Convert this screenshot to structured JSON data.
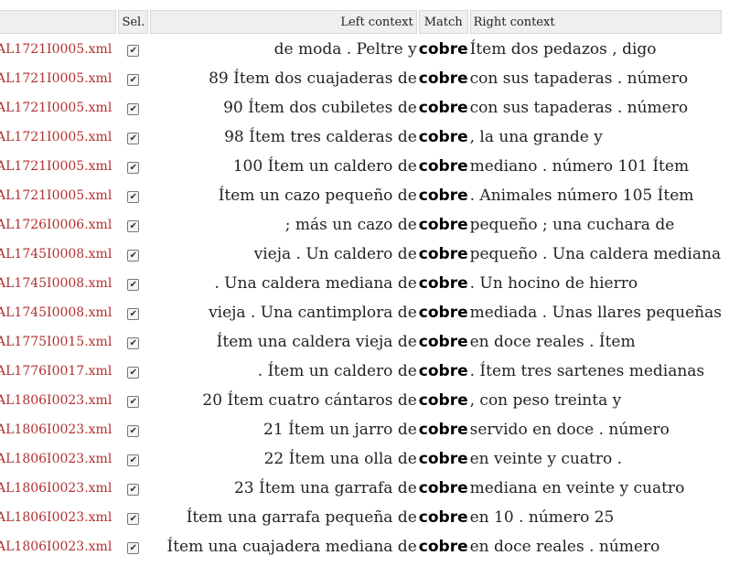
{
  "headers": {
    "file": "",
    "sel": "Sel.",
    "left": "Left context",
    "match": "Match",
    "right": "Right context"
  },
  "checkbox_glyph": "✔",
  "rows": [
    {
      "file": "AL1721I0005.xml",
      "selected": true,
      "left": "de moda . Peltre y",
      "match": "cobre",
      "right": "Ítem dos pedazos , digo"
    },
    {
      "file": "AL1721I0005.xml",
      "selected": true,
      "left": "89 Ítem dos cuajaderas de",
      "match": "cobre",
      "right": "con sus tapaderas . número"
    },
    {
      "file": "AL1721I0005.xml",
      "selected": true,
      "left": "90 Ítem dos cubiletes de",
      "match": "cobre",
      "right": "con sus tapaderas . número"
    },
    {
      "file": "AL1721I0005.xml",
      "selected": true,
      "left": "98 Ítem tres calderas de",
      "match": "cobre",
      "right": ", la una grande y"
    },
    {
      "file": "AL1721I0005.xml",
      "selected": true,
      "left": "100 Ítem un caldero de",
      "match": "cobre",
      "right": "mediano . número 101 Ítem"
    },
    {
      "file": "AL1721I0005.xml",
      "selected": true,
      "left": "Ítem un cazo pequeño de",
      "match": "cobre",
      "right": ". Animales número 105 Ítem"
    },
    {
      "file": "AL1726I0006.xml",
      "selected": true,
      "left": "; más un cazo de",
      "match": "cobre",
      "right": "pequeño ; una cuchara de"
    },
    {
      "file": "AL1745I0008.xml",
      "selected": true,
      "left": "vieja . Un caldero de",
      "match": "cobre",
      "right": "pequeño . Una caldera mediana"
    },
    {
      "file": "AL1745I0008.xml",
      "selected": true,
      "left": ". Una caldera mediana de",
      "match": "cobre",
      "right": ". Un hocino de hierro"
    },
    {
      "file": "AL1745I0008.xml",
      "selected": true,
      "left": "vieja . Una cantimplora de",
      "match": "cobre",
      "right": "mediada . Unas llares pequeñas"
    },
    {
      "file": "AL1775I0015.xml",
      "selected": true,
      "left": "Ítem una caldera vieja de",
      "match": "cobre",
      "right": "en doce reales . Ítem"
    },
    {
      "file": "AL1776I0017.xml",
      "selected": true,
      "left": ". Ítem un caldero de",
      "match": "cobre",
      "right": ". Ítem tres sartenes medianas"
    },
    {
      "file": "AL1806I0023.xml",
      "selected": true,
      "left": "20 Ítem cuatro cántaros de",
      "match": "cobre",
      "right": ", con peso treinta y"
    },
    {
      "file": "AL1806I0023.xml",
      "selected": true,
      "left": "21 Ítem un jarro de",
      "match": "cobre",
      "right": "servido en doce . número"
    },
    {
      "file": "AL1806I0023.xml",
      "selected": true,
      "left": "22 Ítem una olla de",
      "match": "cobre",
      "right": "en veinte y cuatro ."
    },
    {
      "file": "AL1806I0023.xml",
      "selected": true,
      "left": "23 Ítem una garrafa de",
      "match": "cobre",
      "right": "mediana en veinte y cuatro"
    },
    {
      "file": "AL1806I0023.xml",
      "selected": true,
      "left": "Ítem una garrafa pequeña de",
      "match": "cobre",
      "right": "en 10 . número 25"
    },
    {
      "file": "AL1806I0023.xml",
      "selected": true,
      "left": "Ítem una cuajadera mediana de",
      "match": "cobre",
      "right": "en doce reales . número"
    }
  ]
}
